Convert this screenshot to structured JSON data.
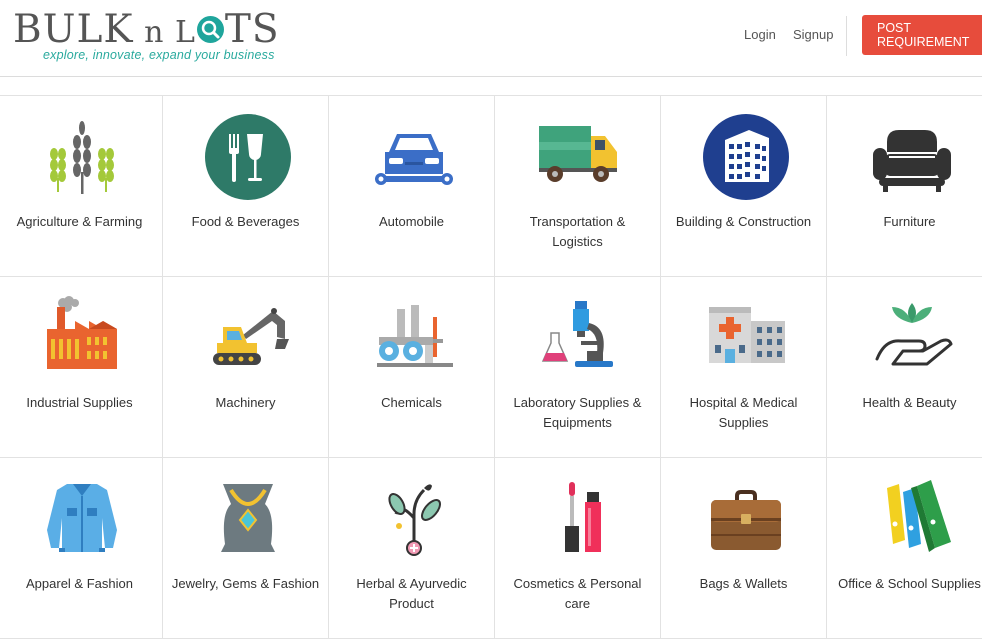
{
  "header": {
    "logo": {
      "part1": "BULK",
      "part2": " n L",
      "part3": "TS"
    },
    "tagline": "explore, innovate, expand your business",
    "nav": {
      "login": "Login",
      "signup": "Signup"
    },
    "post_requirement": "POST REQUIREMENT"
  },
  "categories": [
    {
      "label": "Agriculture & Farming",
      "icon": "wheat-icon"
    },
    {
      "label": "Food & Beverages",
      "icon": "cutlery-icon"
    },
    {
      "label": "Automobile",
      "icon": "car-wrench-icon"
    },
    {
      "label": "Transportation & Logistics",
      "icon": "truck-icon"
    },
    {
      "label": "Building & Construction",
      "icon": "building-icon"
    },
    {
      "label": "Furniture",
      "icon": "sofa-icon"
    },
    {
      "label": "Industrial Supplies",
      "icon": "factory-icon"
    },
    {
      "label": "Machinery",
      "icon": "excavator-icon"
    },
    {
      "label": "Chemicals",
      "icon": "chemical-plant-icon"
    },
    {
      "label": "Laboratory Supplies & Equipments",
      "icon": "microscope-icon"
    },
    {
      "label": "Hospital & Medical Supplies",
      "icon": "hospital-icon"
    },
    {
      "label": "Health & Beauty",
      "icon": "lotus-hand-icon"
    },
    {
      "label": "Apparel & Fashion",
      "icon": "jacket-icon"
    },
    {
      "label": "Jewelry, Gems & Fashion",
      "icon": "necklace-icon"
    },
    {
      "label": "Herbal & Ayurvedic Product",
      "icon": "herbal-icon"
    },
    {
      "label": "Cosmetics & Personal care",
      "icon": "cosmetics-icon"
    },
    {
      "label": "Bags & Wallets",
      "icon": "briefcase-icon"
    },
    {
      "label": "Office & School Supplies",
      "icon": "binders-icon"
    }
  ]
}
